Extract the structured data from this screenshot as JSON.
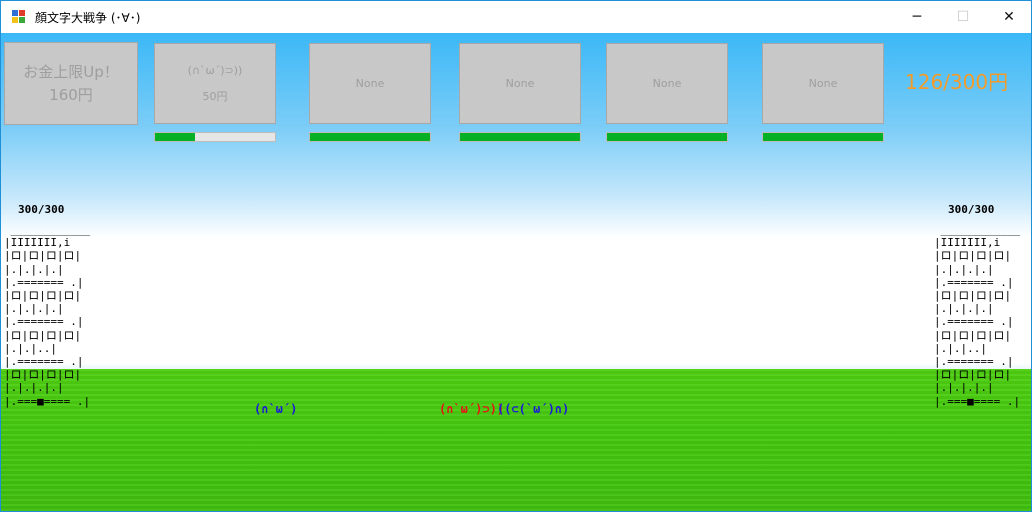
{
  "window": {
    "title": "顔文字大戦争 (･∀･)",
    "controls": {
      "minimize": "─",
      "maximize": "☐",
      "close": "✕"
    }
  },
  "shop": {
    "cards": [
      {
        "line1": "お金上限Up！",
        "line2": "160円",
        "progress": null
      },
      {
        "line1": "(∩`ω´)⊃))",
        "line2": "50円",
        "progress": 0.33
      },
      {
        "line1": "None",
        "line2": "",
        "progress": 1.0
      },
      {
        "line1": "None",
        "line2": "",
        "progress": 1.0
      },
      {
        "line1": "None",
        "line2": "",
        "progress": 1.0
      },
      {
        "line1": "None",
        "line2": "",
        "progress": 1.0
      }
    ],
    "money": "126/300円"
  },
  "colors": {
    "money": "#f39c2b",
    "progress_fill": "#06b025",
    "player_unit": "#1a1ad8",
    "enemy_unit": "#e81414"
  },
  "castles": {
    "left": {
      "hp": "300/300"
    },
    "right": {
      "hp": "300/300"
    },
    "art": " ____________\n|IIIIIII,i\n|ロ|ロ|ロ|ロ|\n|.|.|.|.|\n|.======= .|\n|ロ|ロ|ロ|ロ|\n|.|.|.|.|\n|.======= .|\n|ロ|ロ|ロ|ロ|\n|.|.|..|\n|.======= .|\n|ロ|ロ|ロ|ロ|\n|.|.|.|.|\n|.===■==== .|"
  },
  "units": [
    {
      "text": "(∩`ω´)",
      "side": "player"
    },
    {
      "text": "(∩`ω´)⊃))",
      "side": "enemy"
    },
    {
      "text": "((⊂(`ω´)∩)",
      "side": "player"
    }
  ]
}
